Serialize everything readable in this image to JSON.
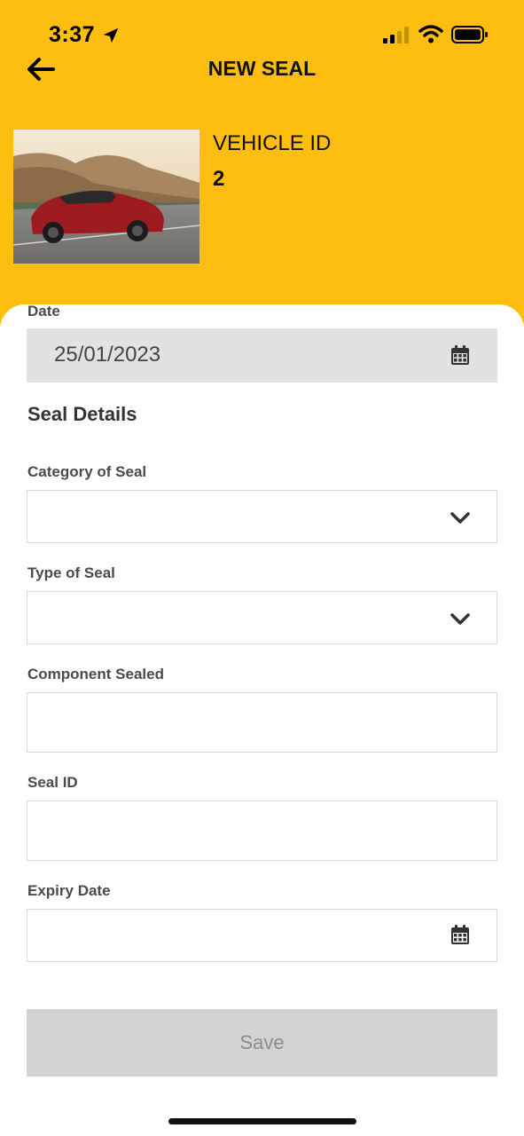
{
  "status_bar": {
    "time": "3:37"
  },
  "header": {
    "title": "NEW SEAL"
  },
  "vehicle": {
    "label": "VEHICLE ID",
    "value": "2"
  },
  "form": {
    "date": {
      "label": "Date",
      "value": "25/01/2023"
    },
    "section_title": "Seal Details",
    "category": {
      "label": "Category of Seal",
      "value": ""
    },
    "type": {
      "label": "Type of Seal",
      "value": ""
    },
    "component": {
      "label": "Component Sealed",
      "value": ""
    },
    "seal_id": {
      "label": "Seal ID",
      "value": ""
    },
    "expiry": {
      "label": "Expiry Date",
      "value": ""
    },
    "save_label": "Save"
  },
  "colors": {
    "accent": "#FDBE10",
    "filled_field": "#e2e2e2",
    "disabled_button": "#d3d3d3"
  },
  "icons": [
    "location-arrow-icon",
    "signal-icon",
    "wifi-icon",
    "battery-icon",
    "back-arrow-icon",
    "calendar-icon",
    "chevron-down-icon"
  ]
}
